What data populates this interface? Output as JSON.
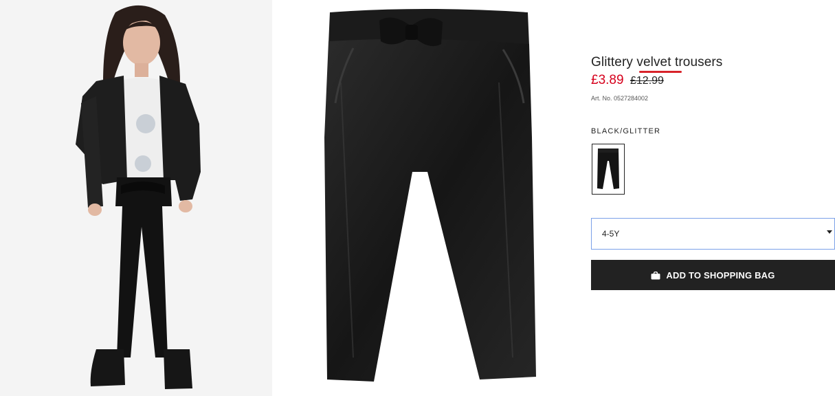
{
  "product": {
    "title_before": "Glittery ",
    "title_misspelled": "velvet",
    "title_after": " trousers",
    "price_current": "£3.89",
    "price_original": "£12.99",
    "article_number": "Art. No. 0527284002",
    "color_label": "BLACK/GLITTER"
  },
  "size_select": {
    "selected": "4-5Y"
  },
  "add_to_bag": {
    "label": "ADD TO SHOPPING BAG",
    "icon": "shopping-bag-icon"
  },
  "colors": {
    "price_red": "#d6001c",
    "spell_underline": "#d8232a",
    "button_bg": "#222222",
    "select_border": "#7aa0e8"
  }
}
